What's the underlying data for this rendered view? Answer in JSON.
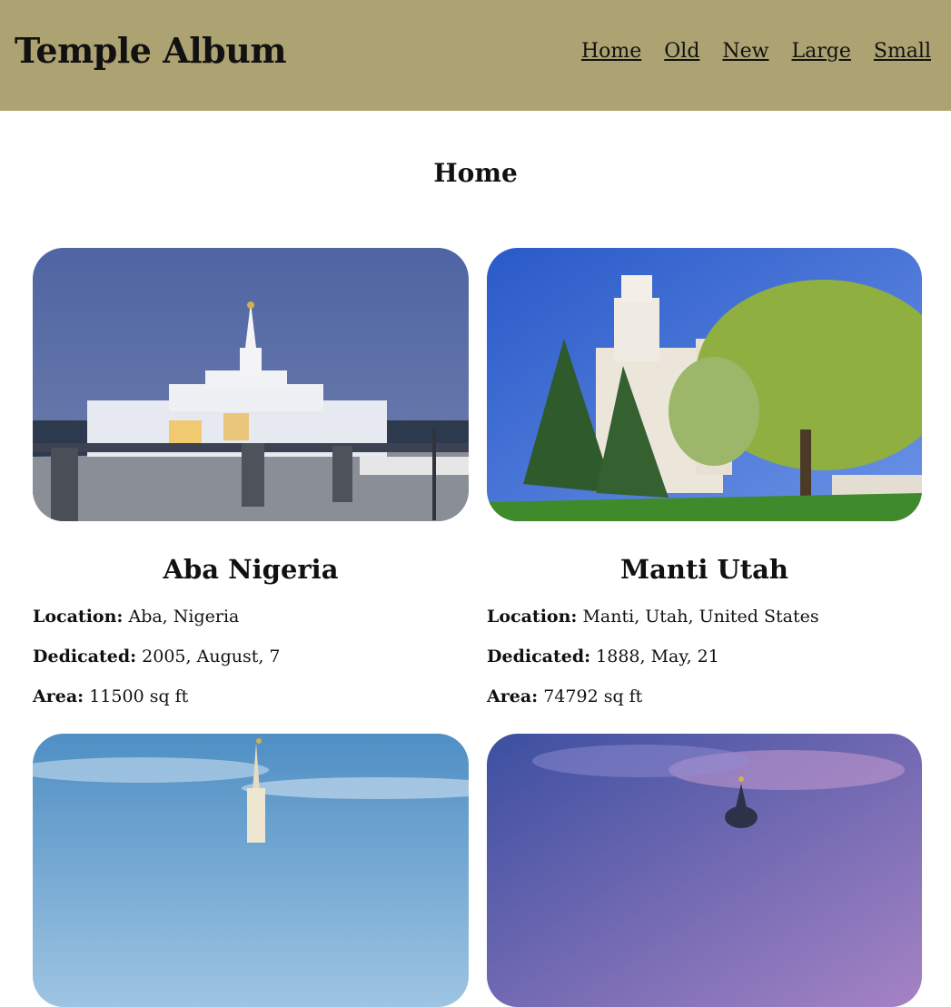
{
  "site": {
    "title": "Temple Album"
  },
  "nav": {
    "items": [
      "Home",
      "Old",
      "New",
      "Large",
      "Small"
    ]
  },
  "page": {
    "title": "Home"
  },
  "labels": {
    "location": "Location:",
    "dedicated": "Dedicated:",
    "area": "Area:"
  },
  "temples": [
    {
      "name": "Aba Nigeria",
      "location": "Aba, Nigeria",
      "dedicated": "2005, August, 7",
      "area": "11500 sq ft"
    },
    {
      "name": "Manti Utah",
      "location": "Manti, Utah, United States",
      "dedicated": "1888, May, 21",
      "area": "74792 sq ft"
    }
  ],
  "colors": {
    "header_bg": "#ada271",
    "text": "#111111",
    "background": "#ffffff"
  }
}
